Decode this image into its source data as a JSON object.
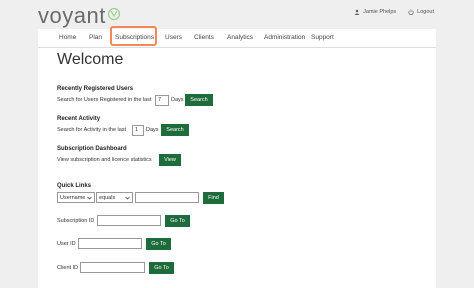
{
  "brand": {
    "name": "voyant"
  },
  "user": {
    "name": "Jamie Phelps",
    "logout": "Logout"
  },
  "nav": [
    "Home",
    "Plan",
    "Subscriptions",
    "Users",
    "Clients",
    "Analytics",
    "Administration",
    "Support"
  ],
  "main": {
    "title": "Welcome",
    "recent_registered": {
      "heading": "Recently Registered Users",
      "text_before": "Search for Users Registered in the last",
      "value": "7",
      "unit": "Days",
      "button": "Search"
    },
    "recent_activity": {
      "heading": "Recent Activity",
      "text_before": "Search for Activity in the last",
      "value": "1",
      "unit": "Days",
      "button": "Search"
    },
    "subscription_dashboard": {
      "heading": "Subscription Dashboard",
      "text": "View subscription and licence statistics",
      "button": "View"
    },
    "quick_links": {
      "heading": "Quick Links",
      "field_select": "Username",
      "op_select": "equals",
      "find_button": "Find",
      "subscription_label": "Subscription ID",
      "user_label": "User ID",
      "client_label": "Client ID",
      "goto_button": "Go To"
    }
  }
}
